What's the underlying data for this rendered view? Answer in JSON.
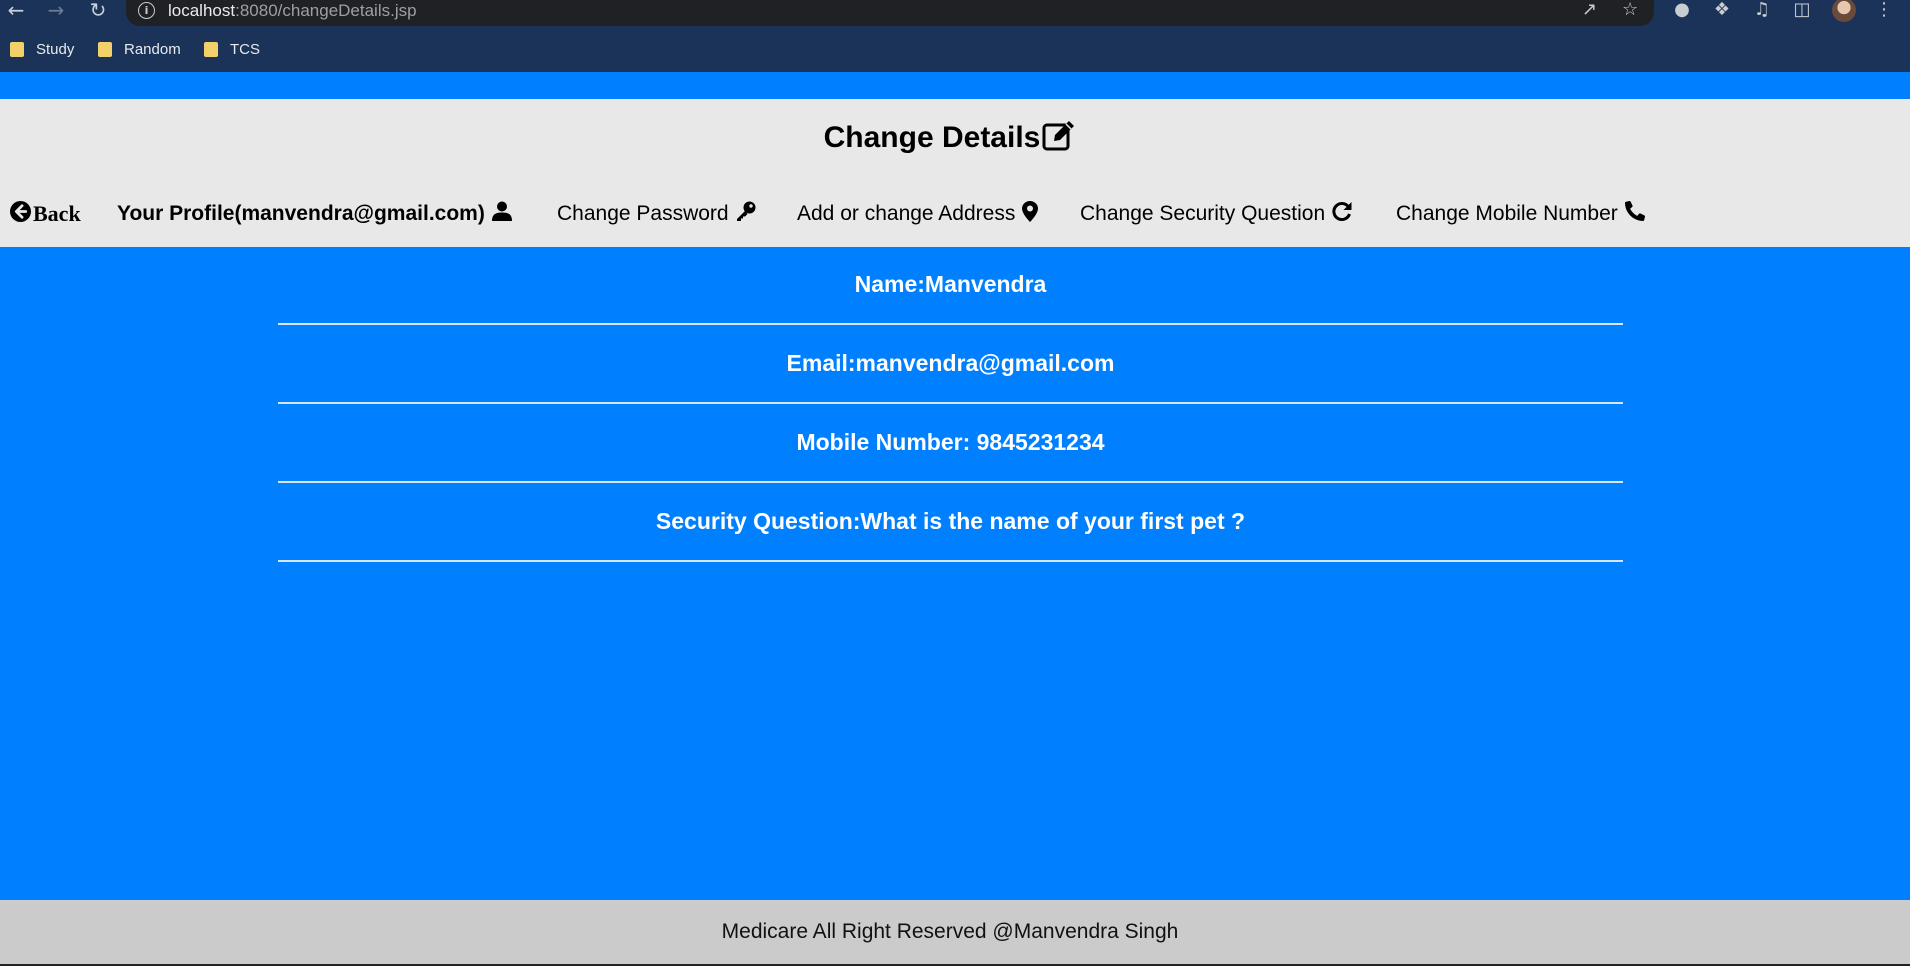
{
  "browser": {
    "url_host": "localhost",
    "url_path": ":8080/changeDetails.jsp",
    "bookmarks": [
      {
        "label": "Study"
      },
      {
        "label": "Random"
      },
      {
        "label": "TCS"
      }
    ]
  },
  "header": {
    "title": "Change Details"
  },
  "nav": {
    "back": "Back",
    "profile": "Your Profile(manvendra@gmail.com)",
    "change_password": "Change Password",
    "address": "Add or change Address",
    "security_question": "Change Security Question",
    "mobile": "Change Mobile Number"
  },
  "details": [
    {
      "text": "Name:Manvendra"
    },
    {
      "text": "Email:manvendra@gmail.com"
    },
    {
      "text": "Mobile Number: 9845231234"
    },
    {
      "text": "Security Question:What is the name of your first pet ?"
    }
  ],
  "footer": {
    "text": "Medicare All Right Reserved @Manvendra Singh"
  },
  "colors": {
    "page_background": "#0080ff",
    "header_background": "#e8e8e8",
    "footer_background": "#cbcbcb",
    "browser_frame": "#1b3359"
  }
}
